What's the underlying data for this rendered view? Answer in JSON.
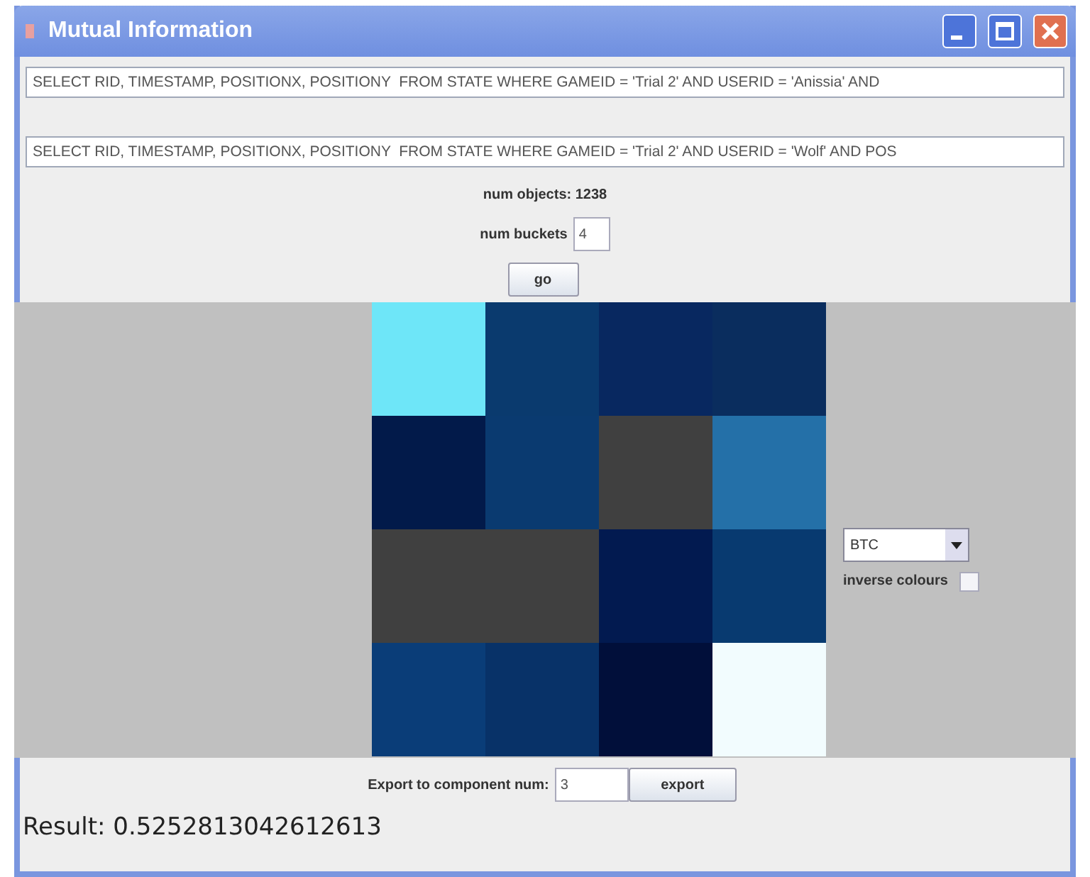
{
  "window": {
    "title": "Mutual Information"
  },
  "queries": [
    {
      "value": "SELECT RID, TIMESTAMP, POSITIONX, POSITIONY  FROM STATE WHERE GAMEID = 'Trial 2' AND USERID = 'Anissia' AND"
    },
    {
      "value": "SELECT RID, TIMESTAMP, POSITIONX, POSITIONY  FROM STATE WHERE GAMEID = 'Trial 2' AND USERID = 'Wolf' AND POS"
    }
  ],
  "num_objects": "num objects: 1238",
  "num_buckets": {
    "label": "num buckets",
    "value": "4"
  },
  "go_button": "go",
  "heatmap": {
    "rows": [
      [
        {
          "color": "#6ee6f8"
        },
        {
          "color": "#0a3a6e"
        },
        {
          "color": "#082860"
        },
        {
          "color": "#0a2d5e"
        }
      ],
      [
        {
          "color": "#021a4a"
        },
        {
          "color": "#0a3a70"
        },
        {
          "color": "#404040"
        },
        {
          "color": "#2470a8"
        }
      ],
      [
        {
          "color": "#404040"
        },
        {
          "color": "#404040"
        },
        {
          "color": "#021a50"
        },
        {
          "color": "#083a70"
        }
      ],
      [
        {
          "color": "#0a3d78"
        },
        {
          "color": "#083268"
        },
        {
          "color": "#010f3a"
        },
        {
          "color": "#f2fcfe"
        }
      ]
    ]
  },
  "colour_scheme": {
    "value": "BTC"
  },
  "inverse_colours": {
    "label": "inverse colours",
    "checked": false
  },
  "export": {
    "label": "Export to component num:",
    "value": "3",
    "button": "export"
  },
  "result": "Result: 0.5252813042612613"
}
